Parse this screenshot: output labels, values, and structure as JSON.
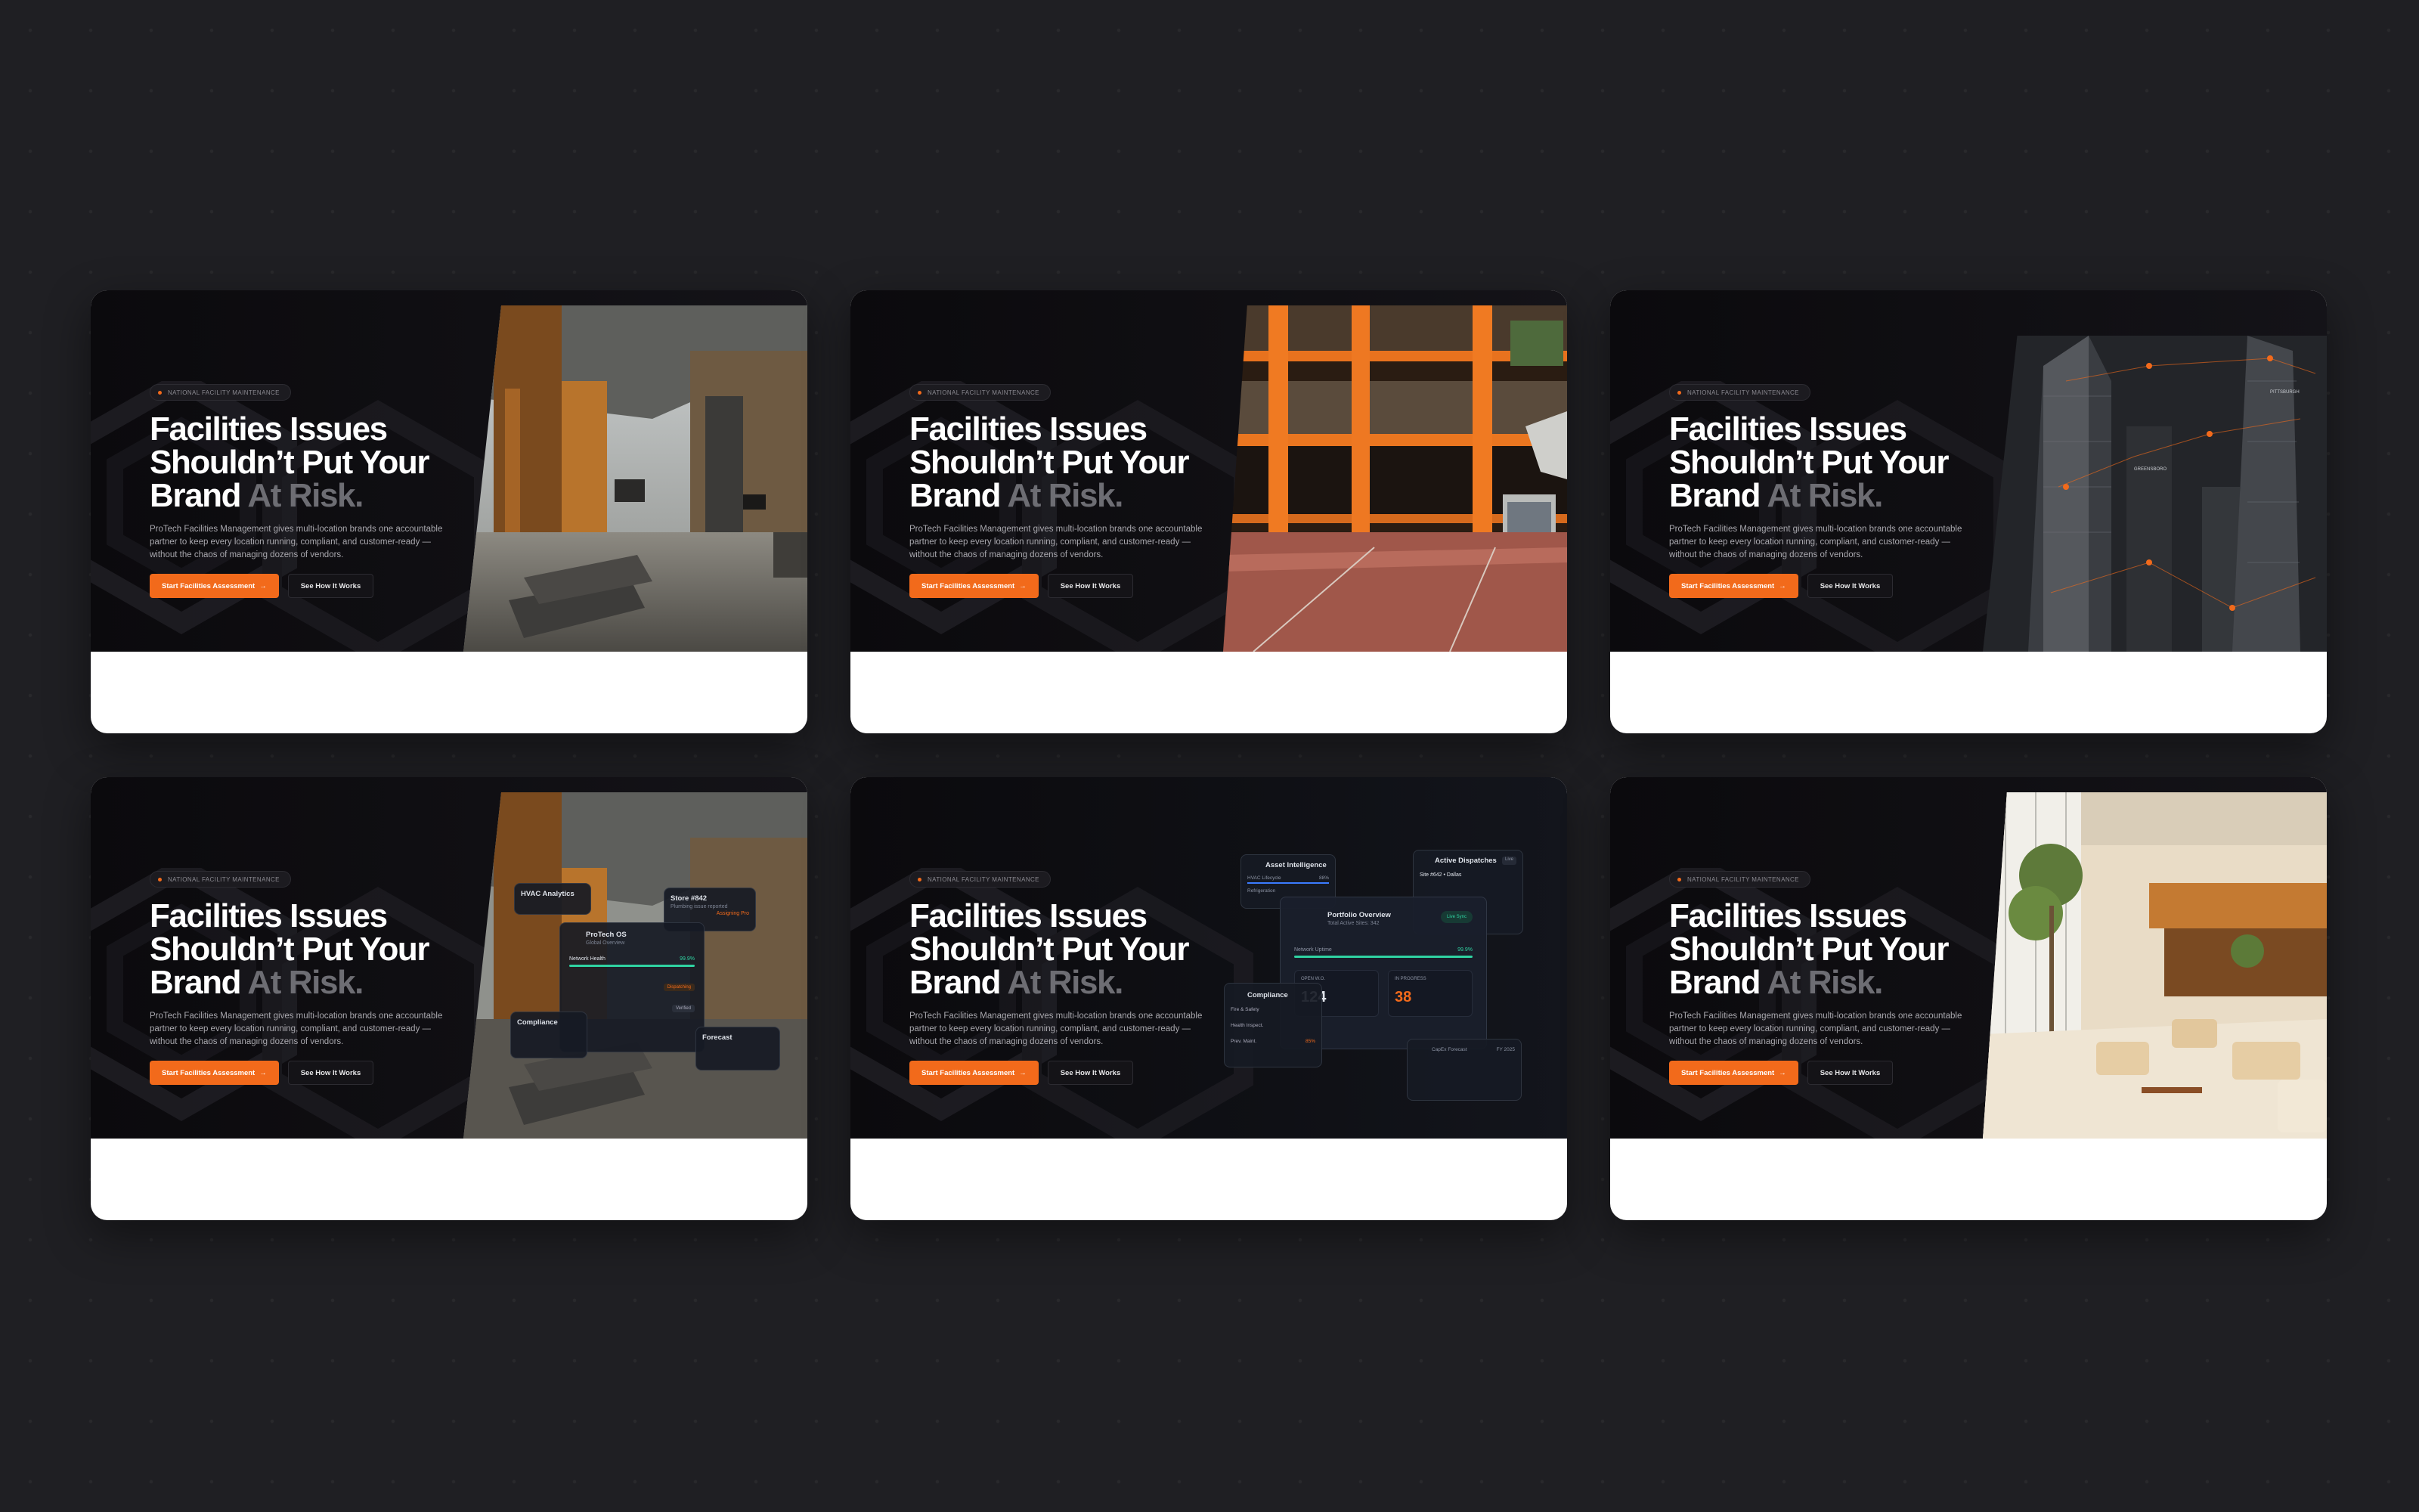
{
  "hero": {
    "badge": "National Facility Maintenance",
    "title_line1": "Facilities Issues",
    "title_line2": "Shouldn’t Put Your",
    "title_line3_plain": "Brand ",
    "title_line3_accent": "At Risk.",
    "description": "ProTech Facilities Management gives multi-location brands one accountable partner to keep every location running, compliant, and customer-ready — without the chaos of managing dozens of vendors.",
    "primary_cta": "Start Facilities Assessment",
    "primary_arrow": "→",
    "secondary_cta": "See How It Works"
  },
  "colors": {
    "accent": "#f26a1b",
    "background": "#1f1f23",
    "hero_bg": "#0b0a0d",
    "card": "#ffffff"
  },
  "variant4": {
    "hvac": "HVAC Analytics",
    "store": "Store #842",
    "store_sub": "Plumbing issue reported",
    "store_status": "Assigning Pro",
    "os_title": "ProTech OS",
    "os_sub": "Global Overview",
    "network": "Network Health",
    "network_val": "99.9%",
    "dispatching": "Dispatching",
    "verified": "Verified",
    "compliance": "Compliance",
    "forecast": "Forecast"
  },
  "variant5": {
    "asset": "Asset Intelligence",
    "hvac_lifecycle": "HVAC Lifecycle",
    "hvac_val": "88%",
    "refrigeration": "Refrigeration",
    "dispatches": "Active Dispatches",
    "live": "Live",
    "site": "Site #642 • Dallas",
    "portfolio": "Portfolio Overview",
    "active_sites": "Total Active Sites: 342",
    "sync": "Live Sync",
    "uptime": "Network Uptime",
    "uptime_val": "99.9%",
    "open_wo": "OPEN W.O.",
    "open_val": "124",
    "in_progress": "IN PROGRESS",
    "progress_val": "38",
    "compliance": "Compliance",
    "fire": "Fire & Safety",
    "health": "Health Inspect.",
    "prev_maint": "Prev. Maint.",
    "prev_val": "85%",
    "capex": "CapEx Forecast",
    "fy": "FY 2025"
  },
  "variant3": {
    "label_a": "GREENSBORO",
    "label_b": "PITTSBURGH"
  }
}
